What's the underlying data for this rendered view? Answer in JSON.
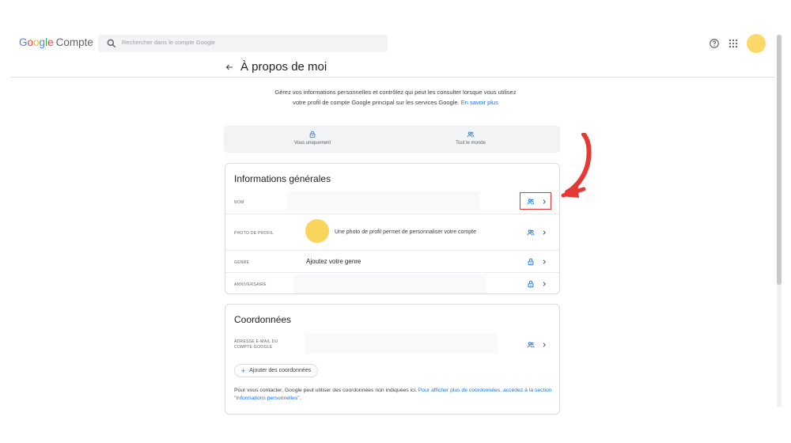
{
  "header": {
    "logo_letters": [
      "G",
      "o",
      "o",
      "g",
      "l",
      "e"
    ],
    "product": "Compte",
    "search_placeholder": "Rechercher dans le compte Google"
  },
  "page": {
    "title": "À propos de moi",
    "intro_text": "Gérez vos informations personnelles et contrôlez qui peut les consulter lorsque vous utilisez votre profil de compte Google principal sur les services Google.",
    "intro_link": "En savoir plus"
  },
  "visibility_legend": {
    "private_label": "Vous uniquement",
    "public_label": "Tout le monde"
  },
  "general_info": {
    "title": "Informations générales",
    "rows": [
      {
        "label": "NOM",
        "value": "",
        "visibility": "people-icon"
      },
      {
        "label": "PHOTO DE PROFIL",
        "value": "Une photo de profil permet de personnaliser votre compte",
        "visibility": "people-icon"
      },
      {
        "label": "GENRE",
        "value": "Ajoutez votre genre",
        "visibility": "lock-icon"
      },
      {
        "label": "ANNIVERSAIRE",
        "value": "",
        "visibility": "lock-icon"
      }
    ]
  },
  "contact_info": {
    "title": "Coordonnées",
    "email_label": "ADRESSE E-MAIL DU COMPTE GOOGLE",
    "add_button": "Ajouter des coordonnées",
    "note_text": "Pour vous contacter, Google peut utiliser des coordonnées non indiquées ici.",
    "note_link": "Pour afficher plus de coordonnées, accédez à la section \"Informations personnelles\"."
  },
  "colors": {
    "accent": "#1a73e8",
    "annotation_red": "#e53935",
    "avatar": "#fbd867"
  }
}
